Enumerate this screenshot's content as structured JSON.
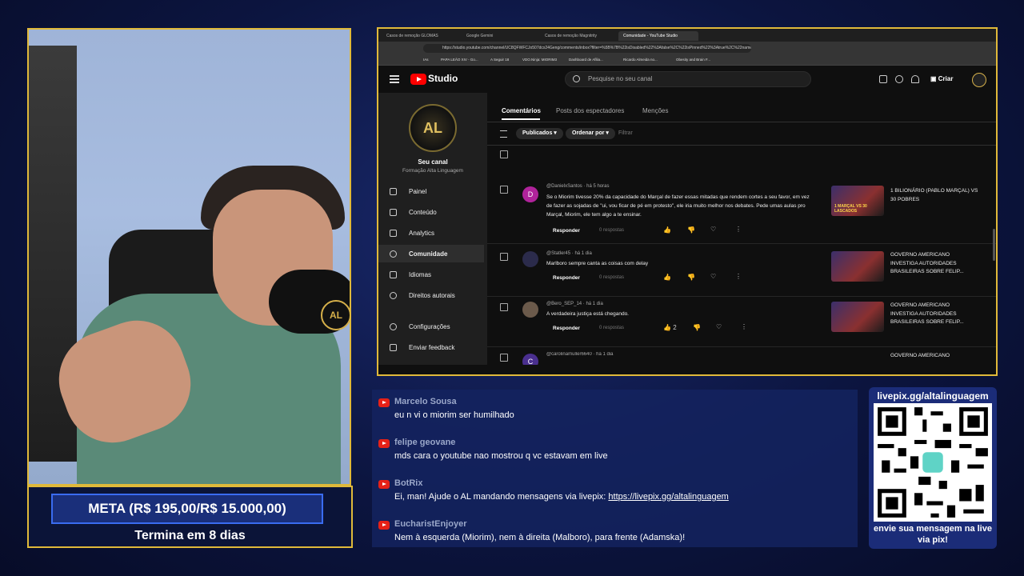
{
  "browser": {
    "tabs": [
      "Casos de remoção GLOMAS",
      "Google Gemini",
      "Casos de remoção Magnitrity",
      "Comunidade - YouTube Studio"
    ],
    "url": "https://studio.youtube.com/channel/UC8QFWFCJo507dcx24Geng/comments/inbox?filter=%5B%7B%22isDisabled%22%3Afalse%2C%22isPinned%22%3Atrue%2C%22name%22%3A...",
    "bookmarks": [
      "IAs",
      "PAPA LEÃO XIV - Go...",
      "A Seguir 18",
      "VDO.Ninja: MIORIM3",
      "Dashboard de Afilia...",
      "Ricardo Almeida no...",
      "Obesity and Brain F..."
    ]
  },
  "studio": {
    "brand": "Studio",
    "search_placeholder": "Pesquise no seu canal",
    "create_label": "Criar",
    "channel_initials": "AL",
    "seu_canal": "Seu canal",
    "channel_name": "Formação Alta Linguagem",
    "nav": [
      "Painel",
      "Conteúdo",
      "Analytics",
      "Comunidade",
      "Idiomas",
      "Direitos autorais",
      "Configurações",
      "Enviar feedback"
    ],
    "tabs": [
      "Comentários",
      "Posts dos espectadores",
      "Menções"
    ],
    "filters": {
      "publicados": "Publicados",
      "ordenar": "Ordenar por",
      "filtrar": "Filtrar"
    },
    "comments": [
      {
        "avatar": "D",
        "avatar_color": "#b0239b",
        "user": "@DanielxSantos · há 5 horas",
        "text": "Se o Miorim tivesse 20% da capacidade do Marçal de fazer essas mitadas que rendem cortes a seu favor, em vez de fazer as sojadas de \"ui, vou ficar de pé em protesto\", ele iria muito melhor nos debates. Pede umas aulas pro Marçal, Miorim, ele tem algo a te ensinar.",
        "reply": "Responder",
        "replies": "0 respostas",
        "likes": "",
        "thumb_label": "1 MARÇAL VS 30 LASCADOS",
        "video": "1 BILIONÁRIO (PABLO MARÇAL) VS 30 POBRES"
      },
      {
        "avatar": "",
        "avatar_color": "#2b2b4b",
        "user": "@Statler45 · há 1 dia",
        "text": "Marlboro sempre canta as coisas com delay",
        "reply": "Responder",
        "replies": "0 respostas",
        "likes": "",
        "thumb_label": "",
        "video": "GOVERNO AMERICANO INVESTIGA AUTORIDADES BRASILEIRAS SOBRE FELIP..."
      },
      {
        "avatar": "",
        "avatar_color": "#6b5a4b",
        "user": "@Bero_SEP_14 · há 1 dia",
        "text": "A verdadeira justiça está chegando.",
        "reply": "Responder",
        "replies": "0 respostas",
        "likes": "2",
        "thumb_label": "",
        "video": "GOVERNO AMERICANO INVESTIGA AUTORIDADES BRASILEIRAS SOBRE FELIP..."
      },
      {
        "avatar": "C",
        "avatar_color": "#4a2f8f",
        "user": "@carolinamuller6640 · há 1 dia",
        "text": "",
        "reply": "",
        "replies": "",
        "likes": "",
        "thumb_label": "",
        "video": "GOVERNO AMERICANO"
      }
    ]
  },
  "overlay": {
    "cam_logo": "AL",
    "meta": "META (R$ 195,00/R$ 15.000,00)",
    "termina": "Termina em 8 dias",
    "qr_url": "livepix.gg/altalinguagem",
    "qr_caption": "envie sua mensagem na live via pix!"
  },
  "chat": [
    {
      "name": "Marcelo Sousa",
      "text": "eu n vi o miorim ser humilhado"
    },
    {
      "name": "felipe geovane",
      "text": "mds cara o youtube nao mostrou q vc estavam em live"
    },
    {
      "name": "BotRix",
      "text": "Ei, man! Ajude o AL mandando mensagens via livepix: ",
      "link": "https://livepix.gg/altalinguagem"
    },
    {
      "name": "EucharistEnjoyer",
      "text": "Nem à esquerda (Miorim), nem à direita (Malboro), para frente (Adamska)!"
    }
  ],
  "colors": {
    "accent_gold": "#e0b93a",
    "yt_red": "#ff0000",
    "chat_name": "#9aa7c9",
    "meta_border": "#3a6cf0"
  }
}
